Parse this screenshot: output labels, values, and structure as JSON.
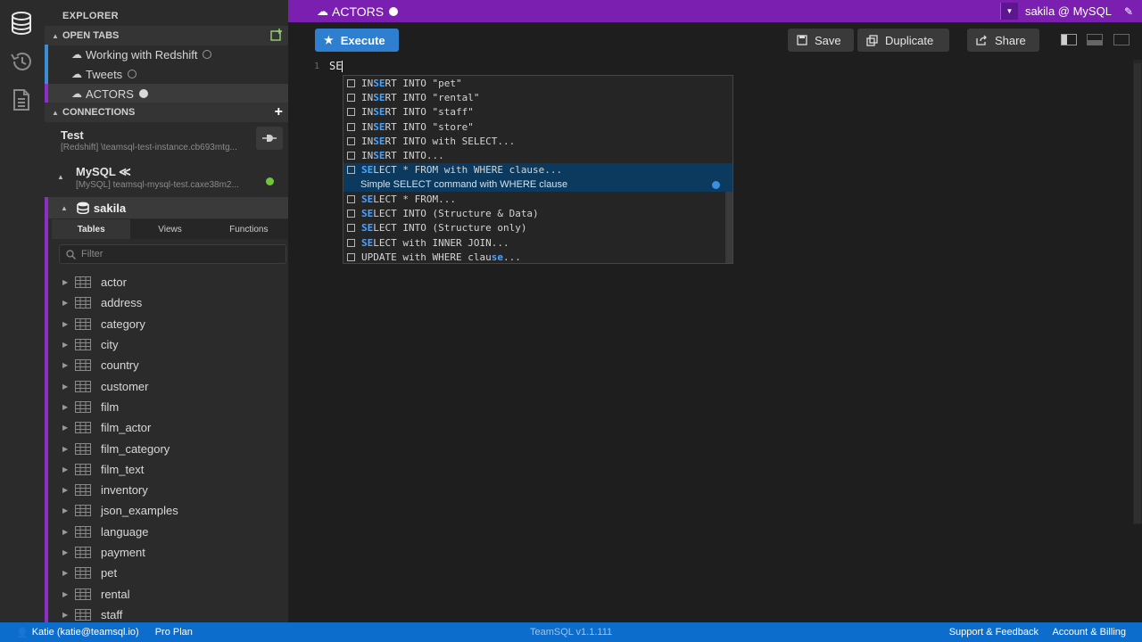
{
  "sidebar": {
    "explorer_title": "EXPLORER",
    "open_tabs_header": "OPEN TABS",
    "open_tabs": [
      {
        "label": "Working with Redshift",
        "color": "#3a8fd4",
        "status": "unsaved"
      },
      {
        "label": "Tweets",
        "color": "#3a8fd4",
        "status": "unsaved"
      },
      {
        "label": "ACTORS",
        "color": "#8e2ec4",
        "status": "active"
      }
    ],
    "connections_header": "CONNECTIONS",
    "connections": [
      {
        "name": "Test",
        "detail": "[Redshift] \\teamsql-test-instance.cb693mtg..."
      },
      {
        "name": "MySQL ≪",
        "detail": "[MySQL] teamsql-mysql-test.caxe38m2...",
        "status_color": "#6fc63c"
      }
    ],
    "database": {
      "name": "sakila",
      "tabs": [
        "Tables",
        "Views",
        "Functions"
      ],
      "active_tab": "Tables",
      "filter_placeholder": "Filter",
      "tables": [
        "actor",
        "address",
        "category",
        "city",
        "country",
        "customer",
        "film",
        "film_actor",
        "film_category",
        "film_text",
        "inventory",
        "json_examples",
        "language",
        "payment",
        "pet",
        "rental",
        "staff"
      ]
    }
  },
  "main": {
    "tab_title": "ACTORS",
    "connection_label": "sakila @ MySQL",
    "toolbar": {
      "execute": "Execute",
      "save": "Save",
      "duplicate": "Duplicate",
      "share": "Share"
    },
    "editor": {
      "line_number": "1",
      "code": "SE"
    },
    "autocomplete": {
      "items": [
        {
          "pre": "IN",
          "match": "SE",
          "post": "RT INTO \"pet\""
        },
        {
          "pre": "IN",
          "match": "SE",
          "post": "RT INTO \"rental\""
        },
        {
          "pre": "IN",
          "match": "SE",
          "post": "RT INTO \"staff\""
        },
        {
          "pre": "IN",
          "match": "SE",
          "post": "RT INTO \"store\""
        },
        {
          "pre": "IN",
          "match": "SE",
          "post": "RT INTO with SELECT..."
        },
        {
          "pre": "IN",
          "match": "SE",
          "post": "RT INTO..."
        },
        {
          "pre": "",
          "match": "SE",
          "post": "LECT * FROM with WHERE clause..."
        },
        {
          "pre": "",
          "match": "SE",
          "post": "LECT * FROM..."
        },
        {
          "pre": "",
          "match": "SE",
          "post": "LECT INTO (Structure & Data)"
        },
        {
          "pre": "",
          "match": "SE",
          "post": "LECT INTO (Structure only)"
        },
        {
          "pre": "",
          "match": "SE",
          "post": "LECT with INNER JOIN..."
        },
        {
          "pre": "UPDATE with WHERE clau",
          "match": "se",
          "post": "..."
        }
      ],
      "selected_index": 6,
      "selected_description": "Simple SELECT command with WHERE clause"
    }
  },
  "statusbar": {
    "user": "Katie (katie@teamsql.io)",
    "plan": "Pro Plan",
    "version": "TeamSQL v1.1.111",
    "support": "Support & Feedback",
    "billing": "Account & Billing"
  },
  "colors": {
    "accent_purple": "#7b1fb1",
    "execute_blue": "#2f7fd0",
    "statusbar_blue": "#0d6dcc",
    "connected_green": "#6fc63c"
  }
}
